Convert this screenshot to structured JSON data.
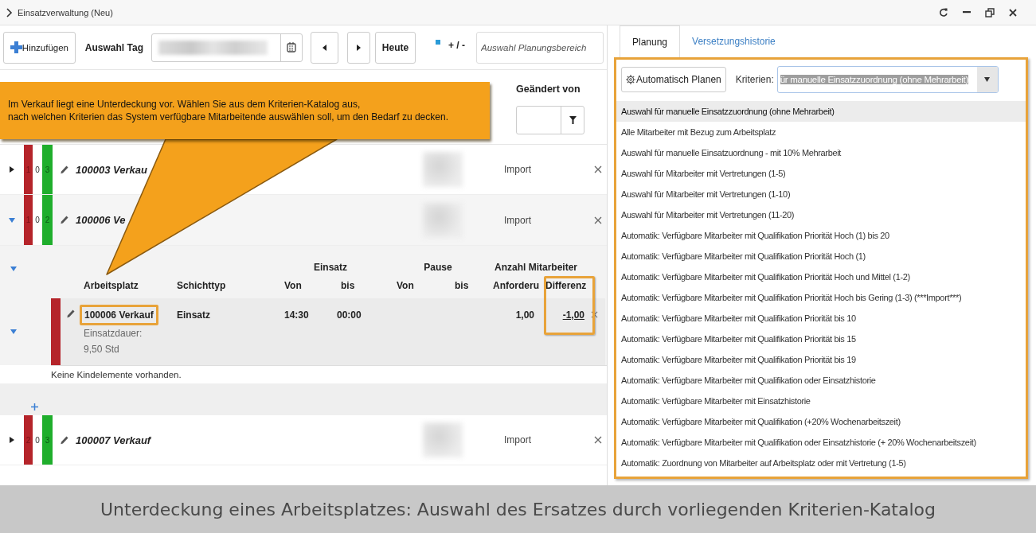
{
  "window": {
    "title": "Einsatzverwaltung (Neu)"
  },
  "toolbar": {
    "add_button": "Hinzufügen",
    "day_label": "Auswahl Tag",
    "today_button": "Heute",
    "toggle_label": "+ / -",
    "area_field": {
      "placeholder": "Auswahl Planungsbereich"
    }
  },
  "list_header": {
    "column_label": "Geändert von"
  },
  "callout": {
    "lines": [
      "Im Verkauf liegt eine Unterdeckung vor. Wählen Sie aus dem Kriterien-Katalog aus,",
      "nach welchen Kriterien das System verfügbare Mitarbeitende auswählen soll, um den Bedarf zu decken."
    ]
  },
  "rows": [
    {
      "expanded": false,
      "counts": [
        "1",
        "0",
        "3"
      ],
      "title": "100003 Verkau",
      "source": "Import"
    },
    {
      "expanded": true,
      "counts": [
        "1",
        "0",
        "2"
      ],
      "title": "100006 Ve",
      "source": "Import"
    },
    {
      "expanded": false,
      "counts": [
        "2",
        "0",
        "3"
      ],
      "title": "100007 Verkauf",
      "source": "Import"
    }
  ],
  "detail": {
    "group_headers": [
      "Einsatz",
      "Pause",
      "Anzahl Mitarbeiter"
    ],
    "columns": [
      "Arbeitsplatz",
      "Schichttyp",
      "Von",
      "bis",
      "Von",
      "bis",
      "Anforderu",
      "Differenz"
    ],
    "entry": {
      "arbeitsplatz": "100006 Verkauf",
      "duration": "Einsatzdauer: 9,50 Std",
      "schichttyp": "Einsatz",
      "von": "14:30",
      "bis": "00:00",
      "anforderung": "1,00",
      "differenz": "-1,00"
    },
    "empty_note": "Keine Kindelemente vorhanden."
  },
  "side_panel": {
    "tabs": [
      {
        "label": "Planung",
        "selected": true
      },
      {
        "label": "Versetzungshistorie",
        "selected": false
      }
    ],
    "auto_plan_button": "Automatisch Planen",
    "criteria_label": "Kriterien:",
    "criteria_value": "ür manuelle Einsatzzuordnung (ohne Mehrarbeit)",
    "options": [
      {
        "label": "Auswahl für manuelle Einsatzzuordnung (ohne Mehrarbeit)",
        "selected": true
      },
      {
        "label": "Alle Mitarbeiter mit Bezug zum Arbeitsplatz",
        "selected": false
      },
      {
        "label": "Auswahl für manuelle Einsatzuordnung - mit 10% Mehrarbeit",
        "selected": false
      },
      {
        "label": "Auswahl für Mitarbeiter mit Vertretungen (1-5)",
        "selected": false
      },
      {
        "label": "Auswahl für Mitarbeiter mit Vertretungen (1-10)",
        "selected": false
      },
      {
        "label": "Auswahl für Mitarbeiter mit Vertretungen (11-20)",
        "selected": false
      },
      {
        "label": "Automatik: Verfügbare Mitarbeiter mit Qualifikation Priorität Hoch (1) bis 20",
        "selected": false
      },
      {
        "label": "Automatik: Verfügbare Mitarbeiter mit Qualifikation Priorität Hoch (1)",
        "selected": false
      },
      {
        "label": "Automatik: Verfügbare Mitarbeiter mit Qualifikation Priorität Hoch und Mittel (1-2)",
        "selected": false
      },
      {
        "label": "Automatik: Verfügbare Mitarbeiter mit Qualifikation Priorität Hoch bis Gering (1-3) (***Import***)",
        "selected": false
      },
      {
        "label": "Automatik: Verfügbare Mitarbeiter mit Qualifikation Priorität bis 10",
        "selected": false
      },
      {
        "label": "Automatik: Verfügbare Mitarbeiter mit Qualifikation Priorität bis 15",
        "selected": false
      },
      {
        "label": "Automatik: Verfügbare Mitarbeiter mit Qualifikation Priorität bis 19",
        "selected": false
      },
      {
        "label": "Automatik: Verfügbare Mitarbeiter mit Qualifikation oder Einsatzhistorie",
        "selected": false
      },
      {
        "label": "Automatik: Verfügbare Mitarbeiter mit Einsatzhistorie",
        "selected": false
      },
      {
        "label": "Automatik: Verfügbare Mitarbeiter mit Qualifikation (+20% Wochenarbeitszeit)",
        "selected": false
      },
      {
        "label": "Automatik: Verfügbare Mitarbeiter mit Qualifikation oder Einsatzhistorie (+ 20% Wochenarbeitszeit)",
        "selected": false
      },
      {
        "label": "Automatik: Zuordnung von Mitarbeiter auf Arbeitsplatz oder mit Vertretung (1-5)",
        "selected": false
      }
    ]
  },
  "caption": "Unterdeckung eines Arbeitsplatzes: Auswahl des Ersatzes durch vorliegenden Kriterien-Katalog"
}
